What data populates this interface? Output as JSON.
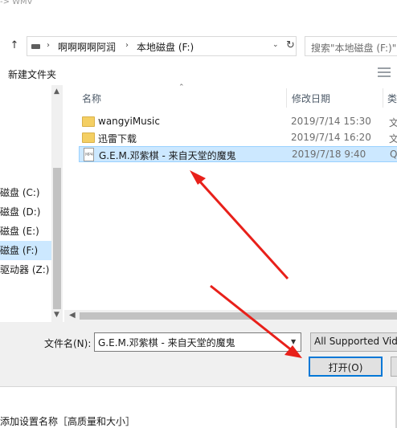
{
  "top_fragment": "-> WMV",
  "address_bar": {
    "breadcrumbs": [
      "啊啊啊啊阿润",
      "本地磁盘 (F:)"
    ],
    "search_placeholder": "搜索\"本地磁盘 (F:)\""
  },
  "toolbar": {
    "new_folder_label": "新建文件夹"
  },
  "nav_pane": {
    "items": [
      {
        "label": "",
        "selected": false
      },
      {
        "label": "",
        "selected": false
      },
      {
        "label": "",
        "selected": false
      },
      {
        "label": "",
        "selected": false
      },
      {
        "label": "",
        "selected": false
      },
      {
        "label": "磁盘 (C:)",
        "selected": false
      },
      {
        "label": "磁盘 (D:)",
        "selected": false
      },
      {
        "label": "磁盘 (E:)",
        "selected": false
      },
      {
        "label": "磁盘 (F:)",
        "selected": true
      },
      {
        "label": "驱动器 (Z:)",
        "selected": false
      }
    ]
  },
  "file_list": {
    "columns": [
      "名称",
      "修改日期",
      "类"
    ],
    "rows": [
      {
        "name": "wangyiMusic",
        "date": "2019/7/14 15:30",
        "type": "文",
        "icon": "folder-icon",
        "selected": false
      },
      {
        "name": "迅雷下载",
        "date": "2019/7/14 16:20",
        "type": "文",
        "icon": "folder-icon",
        "selected": false
      },
      {
        "name": "G.E.M.邓紫棋 - 来自天堂的魔鬼",
        "date": "2019/7/18 9:40",
        "type": "Qu",
        "icon": "mp4-file-icon",
        "file_icon_text": "MP4",
        "selected": true
      }
    ]
  },
  "bottom": {
    "filename_label": "文件名(N):",
    "filename_value": "G.E.M.邓紫棋 - 来自天堂的魔鬼",
    "filter_value": "All Supported Vid",
    "open_label": "打开(O)"
  },
  "app_strip": {
    "label": "添加设置名称［高质量和大小］"
  },
  "colors": {
    "selection": "#cce8ff",
    "accent": "#0078d7",
    "arrow": "#e8201a"
  }
}
